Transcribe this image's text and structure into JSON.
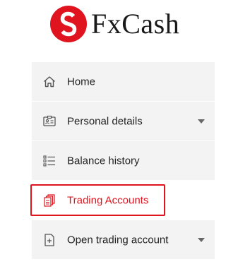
{
  "brand": {
    "name": "FxCash",
    "accent_color": "#e0141e"
  },
  "menu": {
    "items": [
      {
        "label": "Home",
        "icon": "home-icon",
        "has_dropdown": false,
        "active": false
      },
      {
        "label": "Personal details",
        "icon": "id-card-icon",
        "has_dropdown": true,
        "active": false
      },
      {
        "label": "Balance history",
        "icon": "list-icon",
        "has_dropdown": false,
        "active": false
      },
      {
        "label": "Trading Accounts",
        "icon": "documents-icon",
        "has_dropdown": false,
        "active": true
      },
      {
        "label": "Open trading account",
        "icon": "new-document-icon",
        "has_dropdown": true,
        "active": false
      }
    ]
  }
}
